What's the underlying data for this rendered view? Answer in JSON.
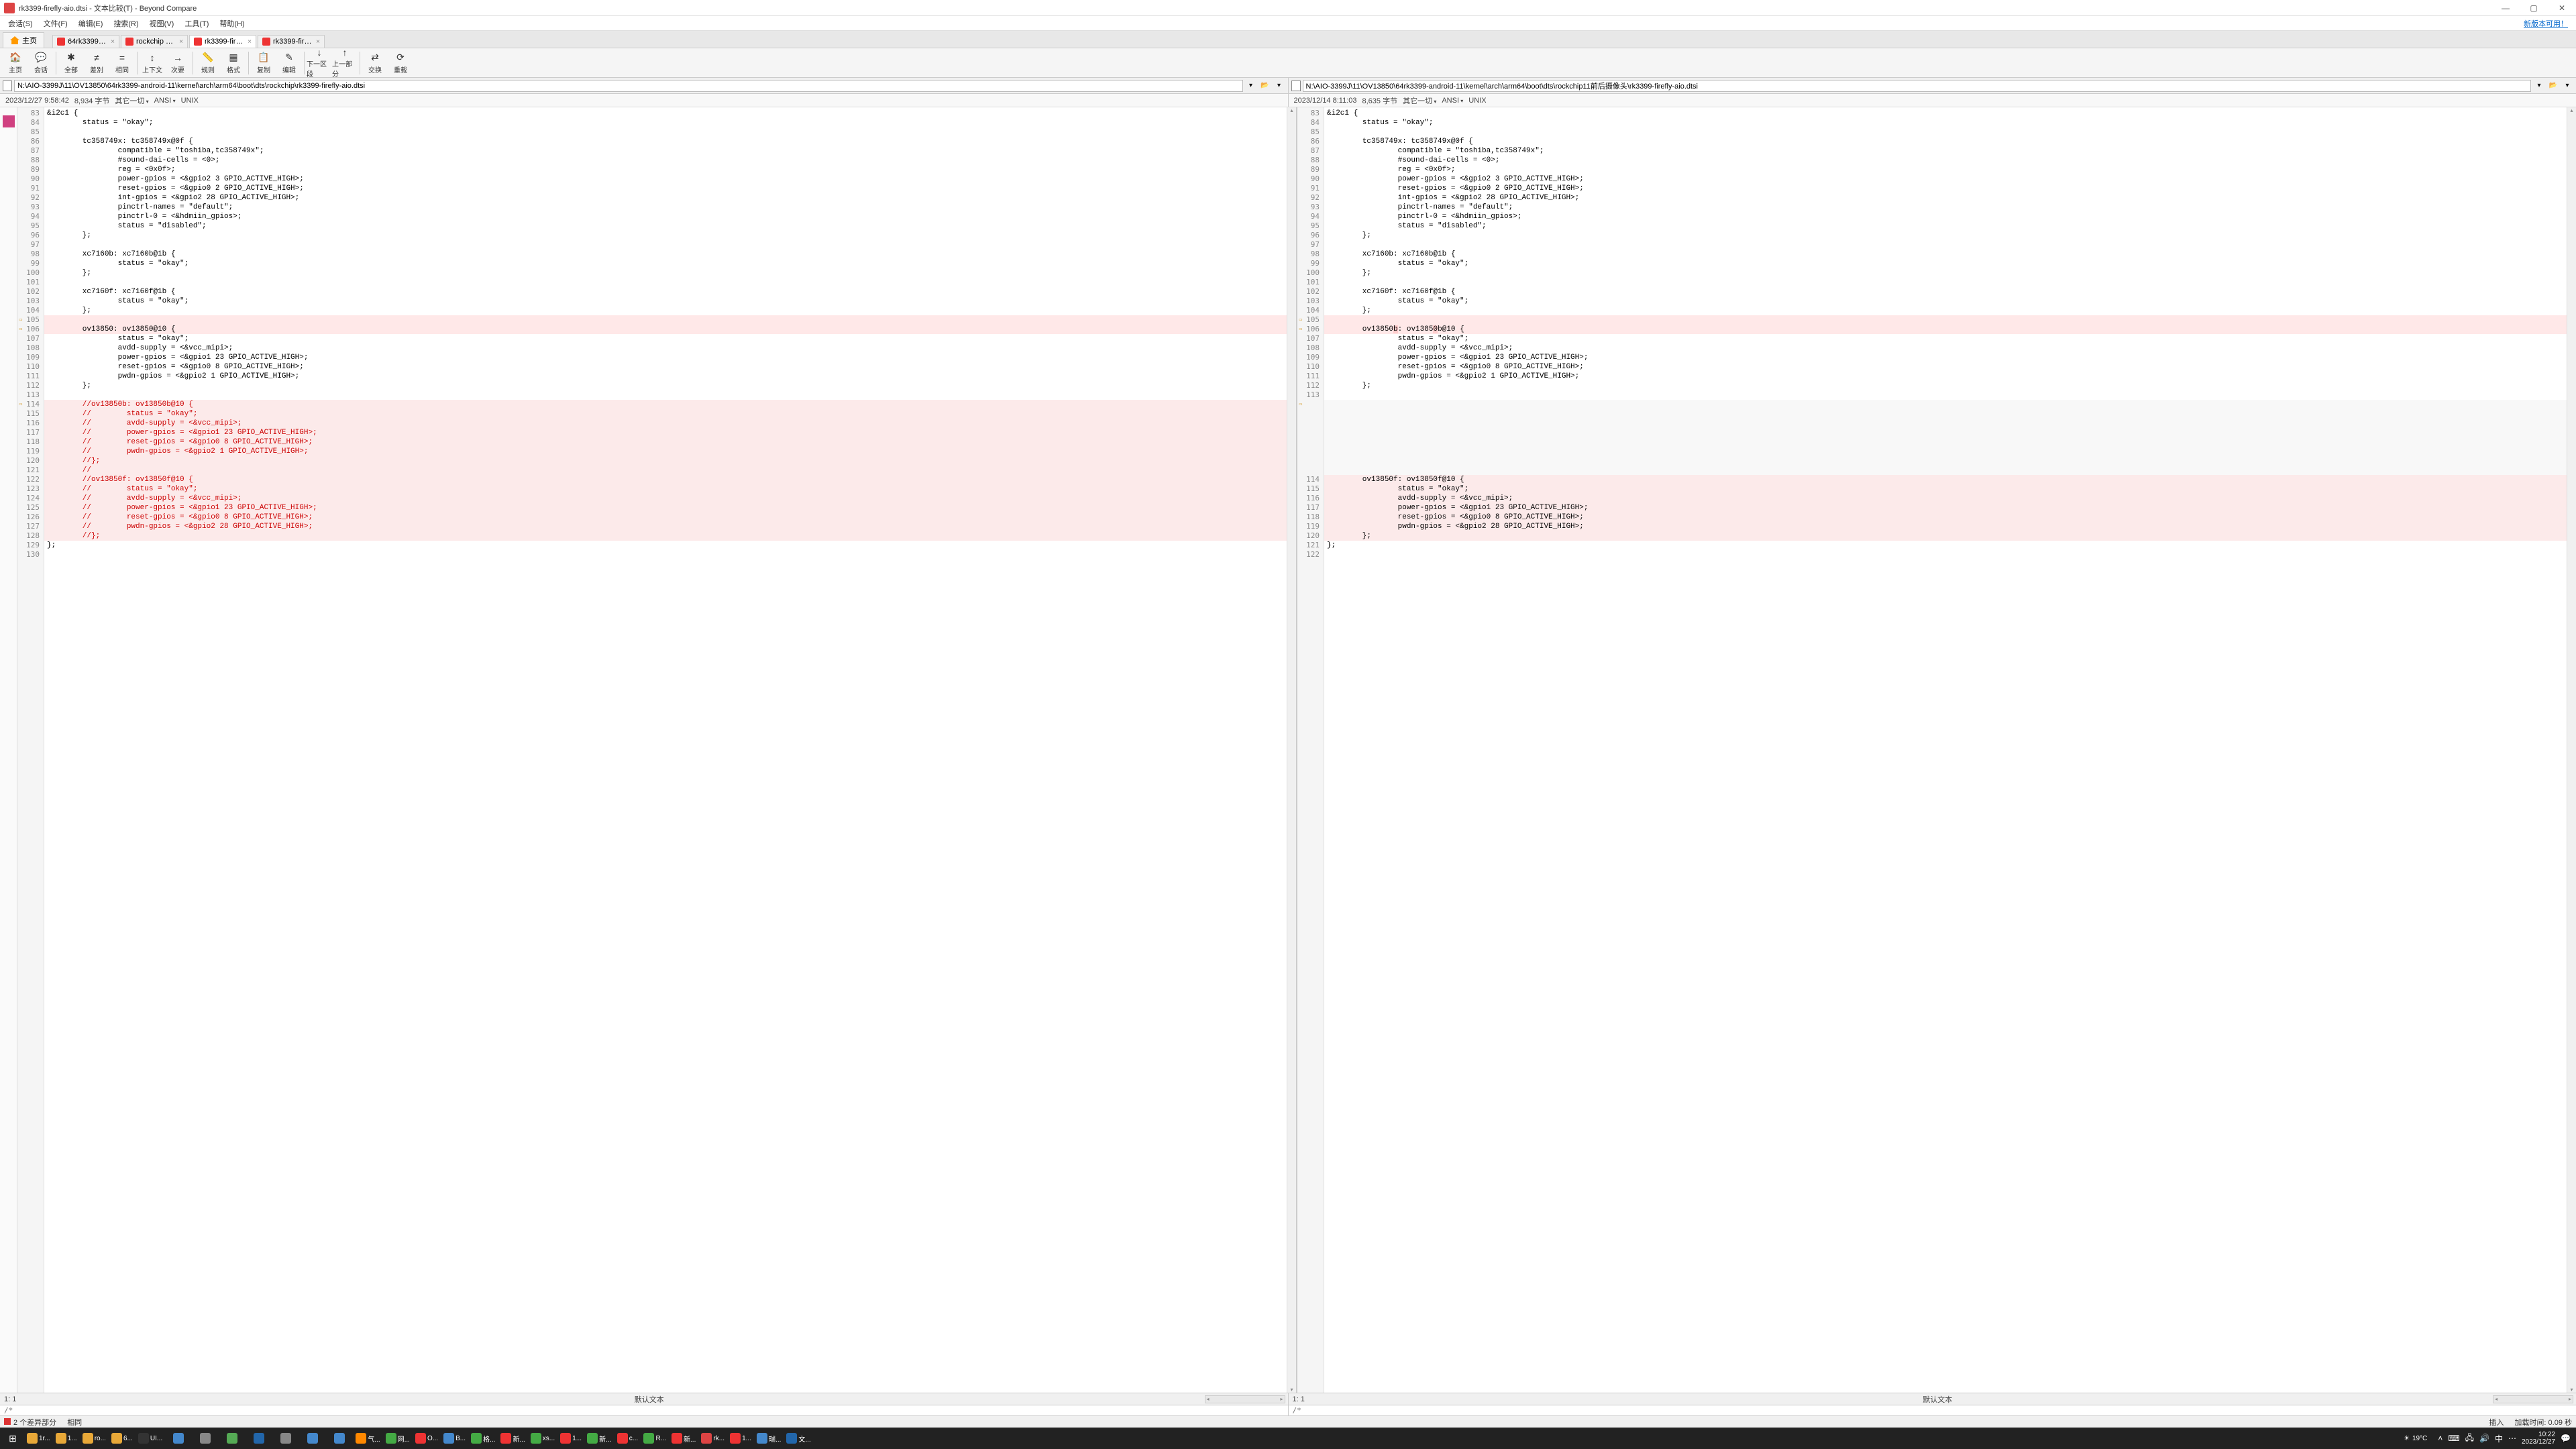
{
  "titlebar": {
    "title": "rk3399-firefly-aio.dtsi - 文本比较(T) - Beyond Compare"
  },
  "menu": {
    "items": [
      "会话(S)",
      "文件(F)",
      "编辑(E)",
      "搜索(R)",
      "视图(V)",
      "工具(T)",
      "帮助(H)"
    ],
    "new_version": "新版本可用！"
  },
  "tabs": {
    "home": "主页",
    "files": [
      {
        "label": "64rk3399-an...",
        "active": false
      },
      {
        "label": "rockchip <-...",
        "active": false
      },
      {
        "label": "rk3399-firefly...",
        "active": true
      },
      {
        "label": "rk3399-firefl...*",
        "active": false
      }
    ]
  },
  "toolbar": [
    {
      "icon": "🏠",
      "label": "主页",
      "key": "home"
    },
    {
      "icon": "💬",
      "label": "会话",
      "key": "session"
    },
    {
      "sep": true
    },
    {
      "icon": "✱",
      "label": "全部",
      "key": "all"
    },
    {
      "icon": "≠",
      "label": "差別",
      "key": "diff"
    },
    {
      "icon": "=",
      "label": "相同",
      "key": "same"
    },
    {
      "sep": true
    },
    {
      "icon": "↕",
      "label": "上下文",
      "key": "context"
    },
    {
      "icon": "→",
      "label": "次要",
      "key": "minor"
    },
    {
      "sep": true
    },
    {
      "icon": "📏",
      "label": "规则",
      "key": "rules"
    },
    {
      "icon": "▦",
      "label": "格式",
      "key": "format"
    },
    {
      "sep": true
    },
    {
      "icon": "📋",
      "label": "复制",
      "key": "copy"
    },
    {
      "icon": "✎",
      "label": "编辑",
      "key": "edit"
    },
    {
      "sep": true
    },
    {
      "icon": "↓",
      "label": "下一区段",
      "key": "nextsec"
    },
    {
      "icon": "↑",
      "label": "上一部分",
      "key": "prevpart"
    },
    {
      "sep": true
    },
    {
      "icon": "⇄",
      "label": "交换",
      "key": "swap"
    },
    {
      "icon": "⟳",
      "label": "重载",
      "key": "reload"
    }
  ],
  "paths": {
    "left": "N:\\AIO-3399J\\11\\OV13850\\64rk3399-android-11\\kernel\\arch\\arm64\\boot\\dts\\rockchip\\rk3399-firefly-aio.dtsi",
    "right": "N:\\AIO-3399J\\11\\OV13850\\64rk3399-android-11\\kernel\\arch\\arm64\\boot\\dts\\rockchip11前后摄像头\\rk3399-firefly-aio.dtsi"
  },
  "info": {
    "left": {
      "date": "2023/12/27 9:58:42",
      "size": "8,934 字节",
      "other": "其它一切",
      "enc": "ANSI",
      "le": "UNIX"
    },
    "right": {
      "date": "2023/12/14 8:11:03",
      "size": "8,635 字节",
      "other": "其它一切",
      "enc": "ANSI",
      "le": "UNIX"
    }
  },
  "left_lines": [
    {
      "n": 83,
      "t": "&i2c1 {"
    },
    {
      "n": 84,
      "t": "        status = \"okay\";"
    },
    {
      "n": 85,
      "t": ""
    },
    {
      "n": 86,
      "t": "        tc358749x: tc358749x@0f {"
    },
    {
      "n": 87,
      "t": "                compatible = \"toshiba,tc358749x\";"
    },
    {
      "n": 88,
      "t": "                #sound-dai-cells = <0>;"
    },
    {
      "n": 89,
      "t": "                reg = <0x0f>;"
    },
    {
      "n": 90,
      "t": "                power-gpios = <&gpio2 3 GPIO_ACTIVE_HIGH>;"
    },
    {
      "n": 91,
      "t": "                reset-gpios = <&gpio0 2 GPIO_ACTIVE_HIGH>;"
    },
    {
      "n": 92,
      "t": "                int-gpios = <&gpio2 28 GPIO_ACTIVE_HIGH>;"
    },
    {
      "n": 93,
      "t": "                pinctrl-names = \"default\";"
    },
    {
      "n": 94,
      "t": "                pinctrl-0 = <&hdmiin_gpios>;"
    },
    {
      "n": 95,
      "t": "                status = \"disabled\";"
    },
    {
      "n": 96,
      "t": "        };"
    },
    {
      "n": 97,
      "t": ""
    },
    {
      "n": 98,
      "t": "        xc7160b: xc7160b@1b {"
    },
    {
      "n": 99,
      "t": "                status = \"okay\";"
    },
    {
      "n": 100,
      "t": "        };"
    },
    {
      "n": 101,
      "t": ""
    },
    {
      "n": 102,
      "t": "        xc7160f: xc7160f@1b {"
    },
    {
      "n": 103,
      "t": "                status = \"okay\";"
    },
    {
      "n": 104,
      "t": "        };"
    },
    {
      "n": 105,
      "t": "",
      "bg": "mod",
      "mark": true
    },
    {
      "n": 106,
      "t": "        ov13850: ov13850@10 {",
      "bg": "mod",
      "mark": true
    },
    {
      "n": 107,
      "t": "                status = \"okay\";"
    },
    {
      "n": 108,
      "t": "                avdd-supply = <&vcc_mipi>;"
    },
    {
      "n": 109,
      "t": "                power-gpios = <&gpio1 23 GPIO_ACTIVE_HIGH>;"
    },
    {
      "n": 110,
      "t": "                reset-gpios = <&gpio0 8 GPIO_ACTIVE_HIGH>;"
    },
    {
      "n": 111,
      "t": "                pwdn-gpios = <&gpio2 1 GPIO_ACTIVE_HIGH>;"
    },
    {
      "n": 112,
      "t": "        };"
    },
    {
      "n": 113,
      "t": ""
    },
    {
      "n": 114,
      "t": "        //ov13850b: ov13850b@10 {",
      "bg": "ins",
      "d": true,
      "mark": true
    },
    {
      "n": 115,
      "t": "        //        status = \"okay\";",
      "bg": "ins",
      "d": true
    },
    {
      "n": 116,
      "t": "        //        avdd-supply = <&vcc_mipi>;",
      "bg": "ins",
      "d": true
    },
    {
      "n": 117,
      "t": "        //        power-gpios = <&gpio1 23 GPIO_ACTIVE_HIGH>;",
      "bg": "ins",
      "d": true
    },
    {
      "n": 118,
      "t": "        //        reset-gpios = <&gpio0 8 GPIO_ACTIVE_HIGH>;",
      "bg": "ins",
      "d": true
    },
    {
      "n": 119,
      "t": "        //        pwdn-gpios = <&gpio2 1 GPIO_ACTIVE_HIGH>;",
      "bg": "ins",
      "d": true
    },
    {
      "n": 120,
      "t": "        //};",
      "bg": "ins",
      "d": true
    },
    {
      "n": 121,
      "t": "        //",
      "bg": "ins",
      "d": true
    },
    {
      "n": 122,
      "t": "        //ov13850f: ov13850f@10 {",
      "bg": "ins",
      "d": true
    },
    {
      "n": 123,
      "t": "        //        status = \"okay\";",
      "bg": "ins",
      "d": true
    },
    {
      "n": 124,
      "t": "        //        avdd-supply = <&vcc_mipi>;",
      "bg": "ins",
      "d": true
    },
    {
      "n": 125,
      "t": "        //        power-gpios = <&gpio1 23 GPIO_ACTIVE_HIGH>;",
      "bg": "ins",
      "d": true
    },
    {
      "n": 126,
      "t": "        //        reset-gpios = <&gpio0 8 GPIO_ACTIVE_HIGH>;",
      "bg": "ins",
      "d": true
    },
    {
      "n": 127,
      "t": "        //        pwdn-gpios = <&gpio2 28 GPIO_ACTIVE_HIGH>;",
      "bg": "ins",
      "d": true
    },
    {
      "n": 128,
      "t": "        //};",
      "bg": "ins",
      "d": true
    },
    {
      "n": 129,
      "t": "};"
    },
    {
      "n": 130,
      "t": ""
    }
  ],
  "right_lines": [
    {
      "n": 83,
      "t": "&i2c1 {"
    },
    {
      "n": 84,
      "t": "        status = \"okay\";"
    },
    {
      "n": 85,
      "t": ""
    },
    {
      "n": 86,
      "t": "        tc358749x: tc358749x@0f {"
    },
    {
      "n": 87,
      "t": "                compatible = \"toshiba,tc358749x\";"
    },
    {
      "n": 88,
      "t": "                #sound-dai-cells = <0>;"
    },
    {
      "n": 89,
      "t": "                reg = <0x0f>;"
    },
    {
      "n": 90,
      "t": "                power-gpios = <&gpio2 3 GPIO_ACTIVE_HIGH>;"
    },
    {
      "n": 91,
      "t": "                reset-gpios = <&gpio0 2 GPIO_ACTIVE_HIGH>;"
    },
    {
      "n": 92,
      "t": "                int-gpios = <&gpio2 28 GPIO_ACTIVE_HIGH>;"
    },
    {
      "n": 93,
      "t": "                pinctrl-names = \"default\";"
    },
    {
      "n": 94,
      "t": "                pinctrl-0 = <&hdmiin_gpios>;"
    },
    {
      "n": 95,
      "t": "                status = \"disabled\";"
    },
    {
      "n": 96,
      "t": "        };"
    },
    {
      "n": 97,
      "t": ""
    },
    {
      "n": 98,
      "t": "        xc7160b: xc7160b@1b {"
    },
    {
      "n": 99,
      "t": "                status = \"okay\";"
    },
    {
      "n": 100,
      "t": "        };"
    },
    {
      "n": 101,
      "t": ""
    },
    {
      "n": 102,
      "t": "        xc7160f: xc7160f@1b {"
    },
    {
      "n": 103,
      "t": "                status = \"okay\";"
    },
    {
      "n": 104,
      "t": "        };"
    },
    {
      "n": 105,
      "t": "",
      "bg": "mod",
      "mark": true
    },
    {
      "n": 106,
      "t": "        ov13850b: ov13850b@10 {",
      "bg": "mod",
      "mark": true,
      "hl": [
        [
          15,
          16
        ],
        [
          24,
          25
        ]
      ]
    },
    {
      "n": 107,
      "t": "                status = \"okay\";"
    },
    {
      "n": 108,
      "t": "                avdd-supply = <&vcc_mipi>;"
    },
    {
      "n": 109,
      "t": "                power-gpios = <&gpio1 23 GPIO_ACTIVE_HIGH>;"
    },
    {
      "n": 110,
      "t": "                reset-gpios = <&gpio0 8 GPIO_ACTIVE_HIGH>;"
    },
    {
      "n": 111,
      "t": "                pwdn-gpios = <&gpio2 1 GPIO_ACTIVE_HIGH>;"
    },
    {
      "n": 112,
      "t": "        };"
    },
    {
      "n": 113,
      "t": ""
    },
    {
      "n": "",
      "t": "",
      "bg": "gap",
      "mark": true
    },
    {
      "n": "",
      "t": "",
      "bg": "gap"
    },
    {
      "n": "",
      "t": "",
      "bg": "gap"
    },
    {
      "n": "",
      "t": "",
      "bg": "gap"
    },
    {
      "n": "",
      "t": "",
      "bg": "gap"
    },
    {
      "n": "",
      "t": "",
      "bg": "gap"
    },
    {
      "n": "",
      "t": "",
      "bg": "gap"
    },
    {
      "n": "",
      "t": "",
      "bg": "gap"
    },
    {
      "n": 114,
      "t": "        ov13850f: ov13850f@10 {",
      "bg": "ins"
    },
    {
      "n": 115,
      "t": "                status = \"okay\";",
      "bg": "ins"
    },
    {
      "n": 116,
      "t": "                avdd-supply = <&vcc_mipi>;",
      "bg": "ins"
    },
    {
      "n": 117,
      "t": "                power-gpios = <&gpio1 23 GPIO_ACTIVE_HIGH>;",
      "bg": "ins"
    },
    {
      "n": 118,
      "t": "                reset-gpios = <&gpio0 8 GPIO_ACTIVE_HIGH>;",
      "bg": "ins"
    },
    {
      "n": 119,
      "t": "                pwdn-gpios = <&gpio2 28 GPIO_ACTIVE_HIGH>;",
      "bg": "ins"
    },
    {
      "n": 120,
      "t": "        };",
      "bg": "ins"
    },
    {
      "n": 121,
      "t": "};"
    },
    {
      "n": 122,
      "t": ""
    }
  ],
  "cursor": {
    "left_pos": "1: 1",
    "right_pos": "1: 1",
    "default_text": "默认文本"
  },
  "preview": {
    "left": "/*",
    "right": "/*"
  },
  "status": {
    "diffs": "2 个差异部分",
    "same": "相同",
    "mode": "插入",
    "load": "加载时间: 0.09 秒"
  },
  "taskbar": {
    "tasks": [
      {
        "label": "1r...",
        "color": "#e8a838"
      },
      {
        "label": "1...",
        "color": "#e8a838"
      },
      {
        "label": "ro...",
        "color": "#e8a838"
      },
      {
        "label": "6...",
        "color": "#e8a838"
      },
      {
        "label": "UI...",
        "color": "#333"
      },
      {
        "label": "",
        "color": "#48c"
      },
      {
        "label": "",
        "color": "#888"
      },
      {
        "label": "",
        "color": "#5a5"
      },
      {
        "label": "",
        "color": "#26a"
      },
      {
        "label": "",
        "color": "#888"
      },
      {
        "label": "",
        "color": "#48c"
      },
      {
        "label": "",
        "color": "#48c"
      },
      {
        "label": "气...",
        "color": "#f80"
      },
      {
        "label": "网...",
        "color": "#4a4"
      },
      {
        "label": "O...",
        "color": "#e33"
      },
      {
        "label": "B...",
        "color": "#48c"
      },
      {
        "label": "格...",
        "color": "#4a4"
      },
      {
        "label": "新...",
        "color": "#e33"
      },
      {
        "label": "xs...",
        "color": "#4a4"
      },
      {
        "label": "1...",
        "color": "#e33"
      },
      {
        "label": "新...",
        "color": "#4a4"
      },
      {
        "label": "c...",
        "color": "#e33"
      },
      {
        "label": "R...",
        "color": "#4a4"
      },
      {
        "label": "新...",
        "color": "#e33"
      },
      {
        "label": "rk...",
        "color": "#d44"
      },
      {
        "label": "1...",
        "color": "#e33"
      },
      {
        "label": "瑞...",
        "color": "#48c"
      },
      {
        "label": "文...",
        "color": "#26a"
      }
    ],
    "weather": "19°C",
    "time": "10:22",
    "date": "2023/12/27"
  }
}
